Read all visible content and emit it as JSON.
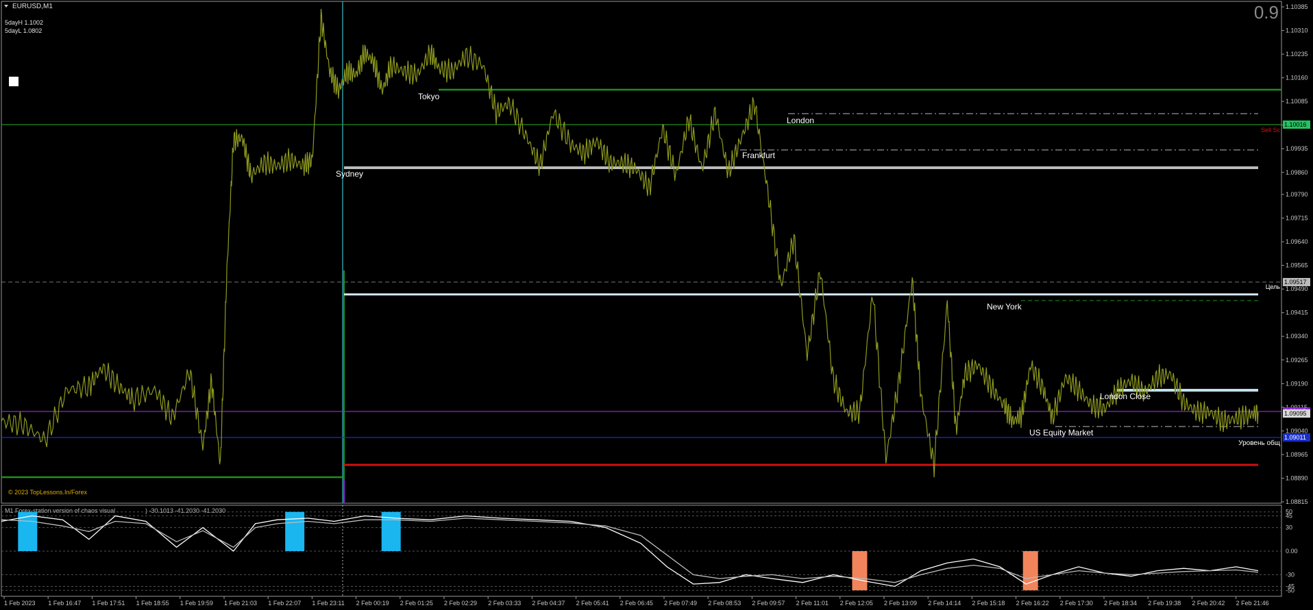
{
  "window": {
    "symbol_title": "EURUSD,M1",
    "spread_value": "0.9",
    "fivedayhigh": "5dayH 1.1002",
    "fivedaylow": "5dayL 1.0802",
    "copyright": "© 2023 TopLessons.In/Forex"
  },
  "colors": {
    "background": "#000000",
    "price": "#8f9a1e",
    "grid_text": "#c8c8c8",
    "green_line": "#1f8f1f",
    "white_line": "#d8ecf4",
    "red_line": "#d01010",
    "blue_line": "#1a2fc8",
    "purple_line": "#8a2bd8",
    "cyan_hist": "#19b6f0",
    "salmon_hist": "#f2845c"
  },
  "sessions": [
    "Sydney",
    "Tokyo",
    "London",
    "Frankfurt",
    "New York",
    "London Close",
    "US Equity Market"
  ],
  "level_labels": {
    "sell": "Sell Sc",
    "target": "Цель",
    "general": "Уровень общ"
  },
  "price_tags": {
    "green": "1.10016",
    "dash": "1.09517",
    "current": "1.09095",
    "purple": "1.09115",
    "blue": "1.09011"
  },
  "indicator": {
    "title": "M1 Forex-station version of chaos visual",
    "values_text": ") -30.1013 -41.2030 -41.2030"
  },
  "chart_data": [
    {
      "type": "line",
      "title": "EURUSD,M1",
      "y_ticks": [
        "1.10385",
        "1.10310",
        "1.10235",
        "1.10160",
        "1.10085",
        "1.10010",
        "1.09935",
        "1.09860",
        "1.09790",
        "1.09715",
        "1.09640",
        "1.09565",
        "1.09490",
        "1.09415",
        "1.09340",
        "1.09265",
        "1.09190",
        "1.09115",
        "1.09040",
        "1.08965",
        "1.08890",
        "1.08815"
      ],
      "x_ticks": [
        "1 Feb 2023",
        "1 Feb 16:47",
        "1 Feb 17:51",
        "1 Feb 18:55",
        "1 Feb 19:59",
        "1 Feb 21:03",
        "1 Feb 22:07",
        "1 Feb 23:11",
        "2 Feb 00:19",
        "2 Feb 01:25",
        "2 Feb 02:29",
        "2 Feb 03:33",
        "2 Feb 04:37",
        "2 Feb 05:41",
        "2 Feb 06:45",
        "2 Feb 07:49",
        "2 Feb 08:53",
        "2 Feb 09:57",
        "2 Feb 11:01",
        "2 Feb 12:05",
        "2 Feb 13:09",
        "2 Feb 14:14",
        "2 Feb 15:18",
        "2 Feb 16:22",
        "2 Feb 17:30",
        "2 Feb 18:34",
        "2 Feb 19:38",
        "2 Feb 20:42",
        "2 Feb 21:46"
      ],
      "ylim": [
        1.08815,
        1.10385
      ],
      "series": [
        {
          "x": [
            0,
            0.5,
            1,
            1.5,
            2,
            2.3,
            2.7,
            3,
            3.5,
            3.9,
            4.3,
            4.6,
            4.8,
            5,
            5.15,
            5.3,
            5.5,
            5.7,
            6,
            6.3,
            6.6,
            6.9,
            7.1,
            7.3,
            7.5,
            7.7,
            7.9,
            8.1,
            8.3,
            8.5,
            8.7,
            8.9,
            9.2,
            9.5,
            9.8,
            10,
            10.3,
            10.6,
            11,
            11.3,
            11.6,
            12,
            12.3,
            12.6,
            13,
            13.3,
            13.6,
            13.9,
            14.2,
            14.5,
            14.8,
            15.1,
            15.4,
            15.7,
            16,
            16.3,
            16.6,
            16.9,
            17.2,
            17.5,
            17.8,
            18.1,
            18.4,
            18.7,
            19,
            19.3,
            19.6,
            19.9,
            20.2,
            20.5,
            20.8,
            21,
            21.3,
            21.6,
            21.8,
            22,
            22.3,
            22.6,
            22.9,
            23.1,
            23.3,
            23.5,
            23.8,
            24,
            24.3,
            24.6,
            24.9,
            25.2,
            25.5,
            25.8,
            26.1,
            26.4,
            26.7,
            27,
            27.3,
            27.6,
            27.9,
            28.2,
            28.5,
            28.7
          ],
          "values": [
            1.0907,
            1.0906,
            1.0901,
            1.0917,
            1.0918,
            1.0924,
            1.0918,
            1.0914,
            1.0917,
            1.0908,
            1.0923,
            1.0899,
            1.092,
            1.0893,
            1.0955,
            1.0996,
            1.0997,
            1.0985,
            1.0989,
            1.0988,
            1.099,
            1.0988,
            1.099,
            1.1035,
            1.1018,
            1.1012,
            1.1018,
            1.1017,
            1.1024,
            1.1021,
            1.1012,
            1.102,
            1.1018,
            1.1017,
            1.1024,
            1.1019,
            1.1018,
            1.1023,
            1.102,
            1.1005,
            1.1008,
            1.0997,
            1.0988,
            1.1005,
            1.0995,
            1.0992,
            1.0996,
            1.0989,
            1.0989,
            1.0987,
            1.0981,
            1.1,
            1.0985,
            1.1003,
            1.0987,
            1.1005,
            1.0986,
            1.0997,
            1.1008,
            1.098,
            1.095,
            1.0965,
            1.0928,
            1.0955,
            1.092,
            1.091,
            1.091,
            1.0948,
            1.0895,
            1.092,
            1.0952,
            1.0915,
            1.0893,
            1.0945,
            1.0904,
            1.0922,
            1.0925,
            1.0918,
            1.0912,
            1.0907,
            1.0909,
            1.0925,
            1.0917,
            1.0908,
            1.0921,
            1.0917,
            1.0912,
            1.0911,
            1.0917,
            1.092,
            1.0916,
            1.0921,
            1.0922,
            1.0913,
            1.091,
            1.091,
            1.0907,
            1.0908,
            1.0909,
            1.091
          ]
        }
      ],
      "levels": [
        {
          "name": "green",
          "value": 1.10016
        },
        {
          "name": "dash",
          "value": 1.09517
        },
        {
          "name": "current",
          "value": 1.09095
        },
        {
          "name": "blue",
          "value": 1.09011
        }
      ]
    },
    {
      "type": "line",
      "title": "M1 Forex-station version of chaos visual",
      "y_ticks": [
        "50",
        "45",
        "30",
        "0.00",
        "-30",
        "-45",
        "-50"
      ],
      "ylim": [
        -55,
        55
      ],
      "series": [
        {
          "x": [
            0,
            0.7,
            1.4,
            2,
            2.6,
            3.3,
            4,
            4.6,
            5.3,
            5.8,
            6.3,
            7,
            7.6,
            8.3,
            9,
            9.8,
            10.6,
            11.4,
            12.2,
            13,
            13.8,
            14.6,
            15.2,
            15.8,
            16.4,
            17,
            17.6,
            18.3,
            19,
            19.7,
            20.4,
            21,
            21.6,
            22.2,
            22.8,
            23.4,
            24,
            24.6,
            25.2,
            25.8,
            26.4,
            27,
            27.6,
            28.2,
            28.7
          ],
          "values": [
            38,
            45,
            40,
            15,
            45,
            38,
            5,
            30,
            0,
            35,
            40,
            42,
            38,
            45,
            42,
            40,
            45,
            42,
            40,
            38,
            30,
            10,
            -20,
            -42,
            -40,
            -30,
            -35,
            -40,
            -30,
            -38,
            -45,
            -25,
            -15,
            -10,
            -20,
            -42,
            -30,
            -20,
            -28,
            -32,
            -25,
            -22,
            -25,
            -20,
            -25
          ]
        },
        {
          "x": [
            0,
            0.7,
            1.4,
            2,
            2.6,
            3.3,
            4,
            4.6,
            5.3,
            5.8,
            6.3,
            7,
            7.6,
            8.3,
            9,
            9.8,
            10.6,
            11.4,
            12.2,
            13,
            13.8,
            14.6,
            15.2,
            15.8,
            16.4,
            17,
            17.6,
            18.3,
            19,
            19.7,
            20.4,
            21,
            21.6,
            22.2,
            22.8,
            23.4,
            24,
            24.6,
            25.2,
            25.8,
            26.4,
            27,
            27.6,
            28.2,
            28.7
          ],
          "values": [
            40,
            38,
            32,
            25,
            38,
            35,
            12,
            26,
            5,
            30,
            35,
            38,
            35,
            40,
            40,
            38,
            42,
            40,
            38,
            36,
            32,
            20,
            -5,
            -30,
            -35,
            -32,
            -30,
            -35,
            -32,
            -35,
            -40,
            -30,
            -22,
            -18,
            -22,
            -35,
            -30,
            -25,
            -28,
            -30,
            -28,
            -26,
            -25,
            -24,
            -27
          ]
        }
      ],
      "bars_positive": [
        {
          "x": 0.6,
          "value": 50
        },
        {
          "x": 6.7,
          "value": 50
        },
        {
          "x": 8.9,
          "value": 50
        }
      ],
      "bars_negative": [
        {
          "x": 19.6,
          "value": -50
        },
        {
          "x": 23.5,
          "value": -50
        }
      ]
    }
  ]
}
